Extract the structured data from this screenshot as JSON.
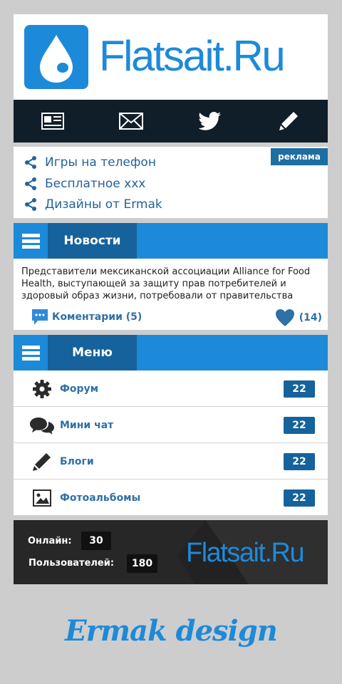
{
  "header": {
    "brand": "Flatsait.Ru",
    "logo_icon": "water-drop-icon",
    "logo_color": "#1d8ad9"
  },
  "nav": {
    "items": [
      {
        "icon": "news-icon"
      },
      {
        "icon": "mail-icon"
      },
      {
        "icon": "twitter-icon"
      },
      {
        "icon": "pencil-icon"
      }
    ]
  },
  "ads": {
    "badge": "реклама",
    "links": [
      {
        "label": "Игры на телефон",
        "icon": "share-icon"
      },
      {
        "label": "Бесплатное xxx",
        "icon": "share-icon"
      },
      {
        "label": "Дизайны от Ermak",
        "icon": "share-icon"
      }
    ]
  },
  "news": {
    "title": "Новости",
    "text": "Представители мексиканской ассоциации Alliance for Food Health, выступающей за защиту прав потребителей и здоровый образ жизни, потребовали от правительства",
    "comments": "Коментарии (5)",
    "likes": "(14)"
  },
  "menu": {
    "title": "Меню",
    "items": [
      {
        "label": "Форум",
        "count": "22",
        "icon": "gear-icon"
      },
      {
        "label": "Мини чат",
        "count": "22",
        "icon": "chat-bubbles-icon"
      },
      {
        "label": "Блоги",
        "count": "22",
        "icon": "pencil-icon"
      },
      {
        "label": "Фотоальбомы",
        "count": "22",
        "icon": "image-icon"
      }
    ]
  },
  "stats": {
    "online_label": "Онлайн:",
    "online_value": "30",
    "users_label": "Пользователей:",
    "users_value": "180",
    "brand": "Flatsait.Ru"
  },
  "signature": "Ermak design",
  "colors": {
    "accent": "#1d8ad9",
    "dark_accent": "#15629c",
    "nav_bg": "#101e2a",
    "footer_bg": "#272727",
    "page_bg": "#cdcdcd"
  }
}
